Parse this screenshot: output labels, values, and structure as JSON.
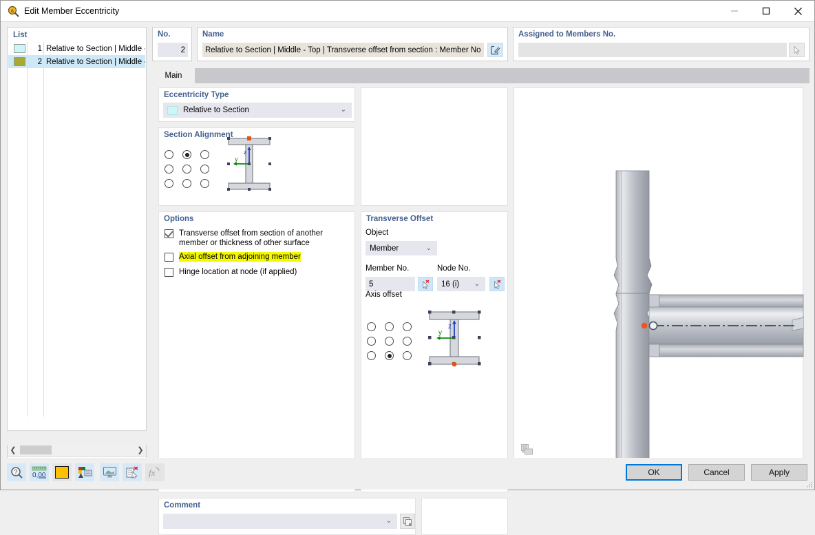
{
  "window": {
    "title": "Edit Member Eccentricity",
    "icon": "member-eccentricity-icon",
    "minimize": "minimize-icon",
    "maximize": "maximize-icon",
    "close": "close-icon"
  },
  "list": {
    "title": "List",
    "rows": [
      {
        "no": "1",
        "label": "Relative to Section | Middle - To",
        "color": "#ccf7f7",
        "selected": false
      },
      {
        "no": "2",
        "label": "Relative to Section | Middle - To",
        "color": "#a8a832",
        "selected": true
      }
    ],
    "scroll_left": "scroll-left-icon",
    "scroll_right": "scroll-right-icon",
    "toolbar": [
      {
        "name": "new-item-button",
        "icon": "new-page-icon"
      },
      {
        "name": "copy-item-button",
        "icon": "copy-page-icon"
      },
      {
        "name": "select-all-button",
        "icon": "check-all-icon"
      },
      {
        "name": "invert-selection-button",
        "icon": "toggle-check-icon"
      },
      {
        "name": "delete-item-button",
        "icon": "red-x-icon"
      }
    ]
  },
  "no_box": {
    "label": "No.",
    "value": "2"
  },
  "name_box": {
    "label": "Name",
    "value": "Relative to Section | Middle - Top | Transverse offset from section : Member No",
    "edit_icon": "edit-pencil-icon"
  },
  "assigned_box": {
    "label": "Assigned to Members No.",
    "value": "",
    "pick_icon": "pick-cursor-icon"
  },
  "tabs": [
    {
      "label": "Main",
      "active": true
    }
  ],
  "eccentricity_type": {
    "title": "Eccentricity Type",
    "selected": "Relative to Section",
    "swatch_color": "#ccf7f7",
    "chevron": "chevron-down-icon"
  },
  "section_alignment": {
    "title": "Section Alignment",
    "grid_rows": 3,
    "grid_cols": 3,
    "selected_index": 1,
    "marker_color": "#e8500f",
    "axis_z_label": "z",
    "axis_y_label": "y"
  },
  "options": {
    "title": "Options",
    "items": [
      {
        "label": "Transverse offset from section of another member or thickness of other surface",
        "checked": true,
        "highlighted": false
      },
      {
        "label": "Axial offset from adjoining member",
        "checked": false,
        "highlighted": true
      },
      {
        "label": "Hinge location at node (if applied)",
        "checked": false,
        "highlighted": false
      }
    ],
    "highlight_color": "#f5f900"
  },
  "transverse_offset": {
    "title": "Transverse Offset",
    "object_label": "Object",
    "object_value": "Member",
    "member_label": "Member No.",
    "member_value": "5",
    "member_pick_icon": "pick-cursor-icon",
    "node_label": "Node No.",
    "node_value": "16 (i)",
    "node_pick_icon": "pick-cursor-icon",
    "axis_offset_label": "Axis offset",
    "axis_grid_rows": 3,
    "axis_grid_cols": 3,
    "axis_selected_index": 7,
    "axis_z_label": "z",
    "axis_y_label": "y",
    "marker_color": "#e8500f"
  },
  "comment": {
    "title": "Comment",
    "value": "",
    "chevron": "chevron-down-icon",
    "copy_icon": "copy-comment-icon"
  },
  "view": {
    "export_icon": "save-image-icon",
    "node_marker_color": "#f0521e"
  },
  "statusbar": {
    "buttons": [
      {
        "name": "help-search-button",
        "icon": "magnifier-question-icon",
        "enabled": true
      },
      {
        "name": "number-format-button",
        "icon": "decimal-places-icon",
        "label": "0,00",
        "enabled": true
      },
      {
        "name": "color-button",
        "icon": "color-swatch-icon",
        "color": "#ffc000",
        "enabled": true
      },
      {
        "name": "render-settings-button",
        "icon": "label-display-icon",
        "enabled": true
      },
      {
        "name": "display-view-button",
        "icon": "monitor-icon",
        "enabled": true
      },
      {
        "name": "select-object-button",
        "icon": "pick-document-icon",
        "enabled": true
      },
      {
        "name": "formula-button",
        "icon": "fx-icon",
        "enabled": false
      }
    ],
    "dialog_buttons": [
      {
        "name": "ok-button",
        "label": "OK",
        "primary": true
      },
      {
        "name": "cancel-button",
        "label": "Cancel",
        "primary": false
      },
      {
        "name": "apply-button",
        "label": "Apply",
        "primary": false
      }
    ]
  }
}
